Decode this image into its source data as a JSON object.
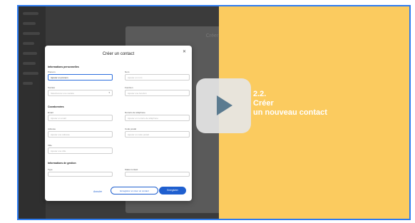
{
  "slide": {
    "headline_line1": "2.2.",
    "headline_line2": "Créer",
    "headline_line3": "un nouveau contact"
  },
  "colors": {
    "accent": "#fbcb5f",
    "frame": "#2d7bf0",
    "primary_button": "#1f5fcf"
  },
  "modal": {
    "title": "Créer un contact",
    "section_personal": "Informations personnelles",
    "section_contact": "Coordonnées",
    "section_management": "Informations de gestion",
    "labels": {
      "first_name": "Prénom",
      "last_name": "Nom",
      "company": "Société",
      "job_title": "Fonction",
      "email": "Email",
      "phone": "Numéro de téléphone",
      "address": "Adresse",
      "postal_code": "Code postal",
      "city": "Ville",
      "type": "Type",
      "status": "Statut contact"
    },
    "values": {
      "first_name": "Ajouter un prénom"
    },
    "placeholders": {
      "last_name": "Ajouter un nom",
      "company": "Sélectionner une société",
      "job_title": "Ajouter une fonction",
      "email": "Ajouter un email",
      "phone": "Ajouter un numéro de téléphone",
      "address": "Ajouter une adresse",
      "postal_code": "Ajouter un code postal",
      "city": "Ajouter une ville"
    },
    "buttons": {
      "cancel": "Annuler",
      "save_and_new": "Enregistrer et créer un contact",
      "save": "Enregistrer"
    }
  }
}
